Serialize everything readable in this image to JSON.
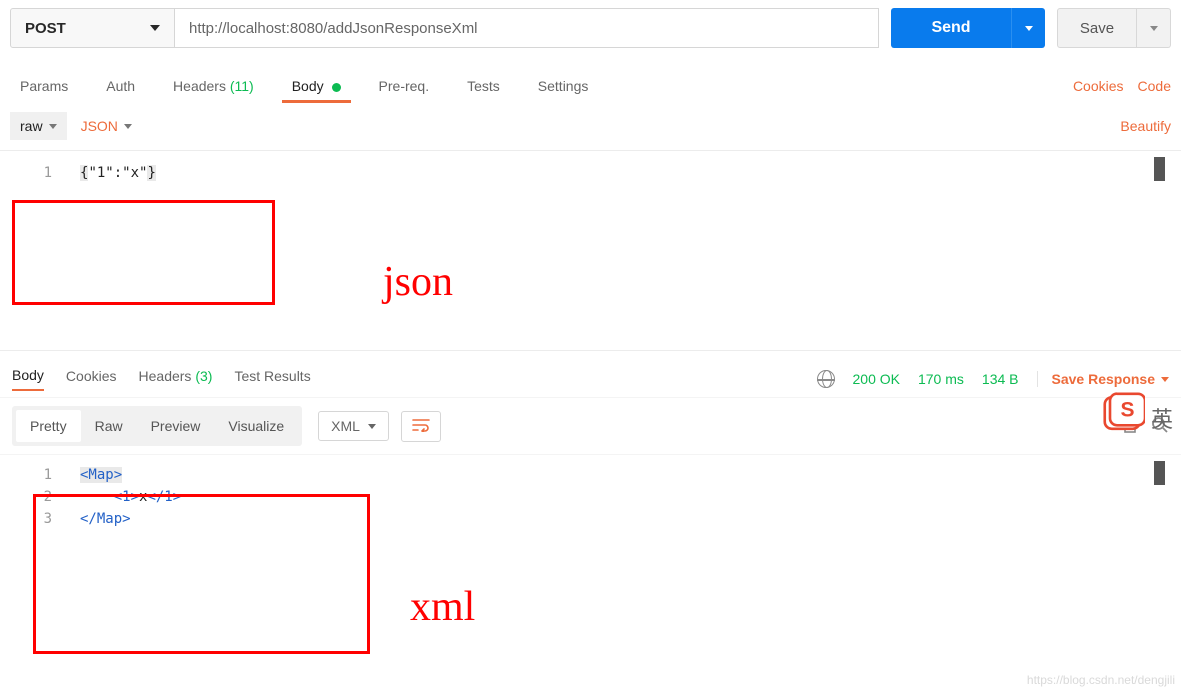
{
  "request": {
    "method": "POST",
    "url": "http://localhost:8080/addJsonResponseXml",
    "send_label": "Send",
    "save_label": "Save"
  },
  "req_tabs": {
    "params": "Params",
    "auth": "Auth",
    "headers": "Headers",
    "headers_count": "(11)",
    "body": "Body",
    "prereq": "Pre-req.",
    "tests": "Tests",
    "settings": "Settings",
    "cookies": "Cookies",
    "code": "Code"
  },
  "body_sub": {
    "raw": "raw",
    "json": "JSON",
    "beautify": "Beautify"
  },
  "req_body_line1": "{\"1\":\"x\"}",
  "annotations": {
    "json": "json",
    "xml": "xml"
  },
  "resp_tabs": {
    "body": "Body",
    "cookies": "Cookies",
    "headers": "Headers",
    "headers_count": "(3)",
    "tests": "Test Results"
  },
  "status": {
    "code": "200 OK",
    "time": "170 ms",
    "size": "134 B",
    "save_resp": "Save Response"
  },
  "resp_sub": {
    "pretty": "Pretty",
    "raw": "Raw",
    "preview": "Preview",
    "visualize": "Visualize",
    "format": "XML"
  },
  "resp_body": {
    "l1_open": "<Map>",
    "l2_open": "<1>",
    "l2_text": "x",
    "l2_close": "</1>",
    "l3_close": "</Map>"
  },
  "sogou_han": "英",
  "watermark": "https://blog.csdn.net/dengjili"
}
